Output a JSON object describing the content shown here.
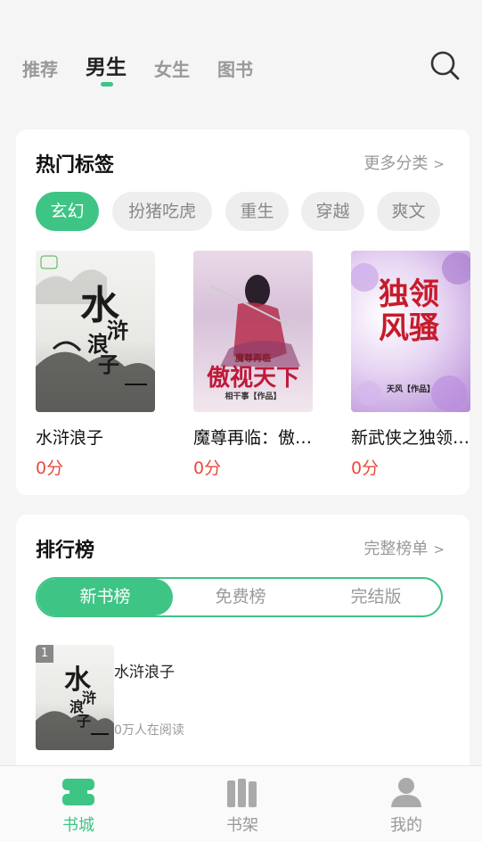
{
  "top_tabs": [
    {
      "label": "推荐",
      "active": false
    },
    {
      "label": "男生",
      "active": true
    },
    {
      "label": "女生",
      "active": false
    },
    {
      "label": "图书",
      "active": false
    }
  ],
  "hot_tags": {
    "title": "热门标签",
    "more": "更多分类",
    "more_arrow": ">",
    "tags": [
      "玄幻",
      "扮猪吃虎",
      "重生",
      "穿越",
      "爽文"
    ],
    "books": [
      {
        "name": "水浒浪子",
        "score": "0分",
        "cover_text": "水浒浪子",
        "cover_icon": "ink-landscape-cover"
      },
      {
        "name": "魔尊再临：傲视天下",
        "score": "0分",
        "cover_text": "傲视天下",
        "cover_sub": "魔尊再临",
        "cover_author": "相干事【作品】",
        "cover_icon": "swordsman-cover"
      },
      {
        "name": "新武侠之独领风骚",
        "score": "0分",
        "cover_text": "独领风骚",
        "cover_author": "天风【作品】",
        "cover_icon": "purple-flower-cover"
      }
    ]
  },
  "ranking": {
    "title": "排行榜",
    "more": "完整榜单",
    "more_arrow": ">",
    "tabs": [
      {
        "label": "新书榜",
        "active": true
      },
      {
        "label": "免费榜",
        "active": false
      },
      {
        "label": "完结版",
        "active": false
      }
    ],
    "items": [
      {
        "rank": "1",
        "name": "水浒浪子",
        "readers": "0万人在阅读",
        "cover_text": "水浒浪子"
      }
    ]
  },
  "bottom_nav": [
    {
      "label": "书城",
      "icon": "bookstore-icon",
      "active": true
    },
    {
      "label": "书架",
      "icon": "bookshelf-icon",
      "active": false
    },
    {
      "label": "我的",
      "icon": "profile-icon",
      "active": false
    }
  ],
  "colors": {
    "accent": "#3ec485",
    "score": "#e84b3c",
    "background": "#f5f5f5"
  }
}
